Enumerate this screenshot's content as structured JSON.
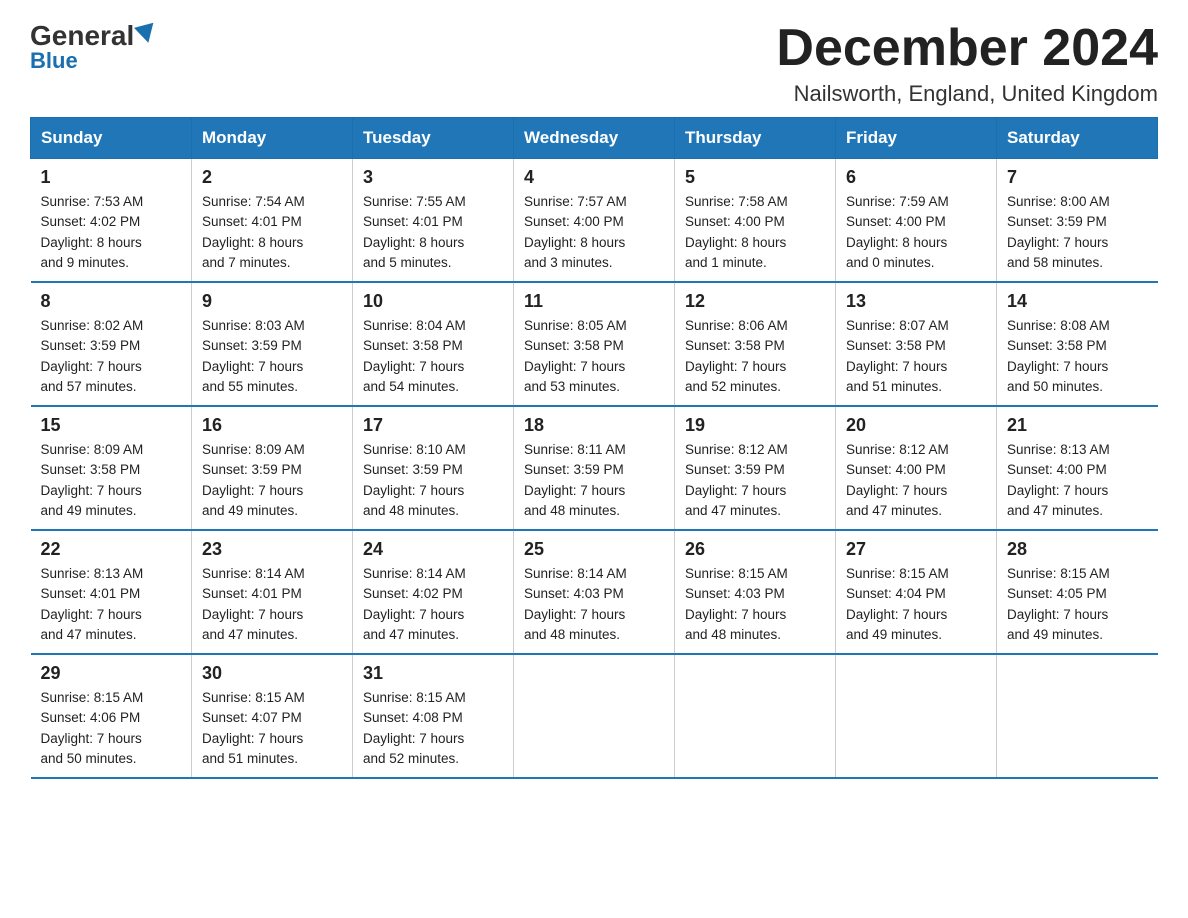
{
  "logo": {
    "general": "General",
    "blue": "Blue",
    "subtitle": "Blue"
  },
  "header": {
    "month_title": "December 2024",
    "location": "Nailsworth, England, United Kingdom"
  },
  "days_of_week": [
    "Sunday",
    "Monday",
    "Tuesday",
    "Wednesday",
    "Thursday",
    "Friday",
    "Saturday"
  ],
  "weeks": [
    [
      {
        "day": "1",
        "sunrise": "7:53 AM",
        "sunset": "4:02 PM",
        "daylight": "8 hours and 9 minutes."
      },
      {
        "day": "2",
        "sunrise": "7:54 AM",
        "sunset": "4:01 PM",
        "daylight": "8 hours and 7 minutes."
      },
      {
        "day": "3",
        "sunrise": "7:55 AM",
        "sunset": "4:01 PM",
        "daylight": "8 hours and 5 minutes."
      },
      {
        "day": "4",
        "sunrise": "7:57 AM",
        "sunset": "4:00 PM",
        "daylight": "8 hours and 3 minutes."
      },
      {
        "day": "5",
        "sunrise": "7:58 AM",
        "sunset": "4:00 PM",
        "daylight": "8 hours and 1 minute."
      },
      {
        "day": "6",
        "sunrise": "7:59 AM",
        "sunset": "4:00 PM",
        "daylight": "8 hours and 0 minutes."
      },
      {
        "day": "7",
        "sunrise": "8:00 AM",
        "sunset": "3:59 PM",
        "daylight": "7 hours and 58 minutes."
      }
    ],
    [
      {
        "day": "8",
        "sunrise": "8:02 AM",
        "sunset": "3:59 PM",
        "daylight": "7 hours and 57 minutes."
      },
      {
        "day": "9",
        "sunrise": "8:03 AM",
        "sunset": "3:59 PM",
        "daylight": "7 hours and 55 minutes."
      },
      {
        "day": "10",
        "sunrise": "8:04 AM",
        "sunset": "3:58 PM",
        "daylight": "7 hours and 54 minutes."
      },
      {
        "day": "11",
        "sunrise": "8:05 AM",
        "sunset": "3:58 PM",
        "daylight": "7 hours and 53 minutes."
      },
      {
        "day": "12",
        "sunrise": "8:06 AM",
        "sunset": "3:58 PM",
        "daylight": "7 hours and 52 minutes."
      },
      {
        "day": "13",
        "sunrise": "8:07 AM",
        "sunset": "3:58 PM",
        "daylight": "7 hours and 51 minutes."
      },
      {
        "day": "14",
        "sunrise": "8:08 AM",
        "sunset": "3:58 PM",
        "daylight": "7 hours and 50 minutes."
      }
    ],
    [
      {
        "day": "15",
        "sunrise": "8:09 AM",
        "sunset": "3:58 PM",
        "daylight": "7 hours and 49 minutes."
      },
      {
        "day": "16",
        "sunrise": "8:09 AM",
        "sunset": "3:59 PM",
        "daylight": "7 hours and 49 minutes."
      },
      {
        "day": "17",
        "sunrise": "8:10 AM",
        "sunset": "3:59 PM",
        "daylight": "7 hours and 48 minutes."
      },
      {
        "day": "18",
        "sunrise": "8:11 AM",
        "sunset": "3:59 PM",
        "daylight": "7 hours and 48 minutes."
      },
      {
        "day": "19",
        "sunrise": "8:12 AM",
        "sunset": "3:59 PM",
        "daylight": "7 hours and 47 minutes."
      },
      {
        "day": "20",
        "sunrise": "8:12 AM",
        "sunset": "4:00 PM",
        "daylight": "7 hours and 47 minutes."
      },
      {
        "day": "21",
        "sunrise": "8:13 AM",
        "sunset": "4:00 PM",
        "daylight": "7 hours and 47 minutes."
      }
    ],
    [
      {
        "day": "22",
        "sunrise": "8:13 AM",
        "sunset": "4:01 PM",
        "daylight": "7 hours and 47 minutes."
      },
      {
        "day": "23",
        "sunrise": "8:14 AM",
        "sunset": "4:01 PM",
        "daylight": "7 hours and 47 minutes."
      },
      {
        "day": "24",
        "sunrise": "8:14 AM",
        "sunset": "4:02 PM",
        "daylight": "7 hours and 47 minutes."
      },
      {
        "day": "25",
        "sunrise": "8:14 AM",
        "sunset": "4:03 PM",
        "daylight": "7 hours and 48 minutes."
      },
      {
        "day": "26",
        "sunrise": "8:15 AM",
        "sunset": "4:03 PM",
        "daylight": "7 hours and 48 minutes."
      },
      {
        "day": "27",
        "sunrise": "8:15 AM",
        "sunset": "4:04 PM",
        "daylight": "7 hours and 49 minutes."
      },
      {
        "day": "28",
        "sunrise": "8:15 AM",
        "sunset": "4:05 PM",
        "daylight": "7 hours and 49 minutes."
      }
    ],
    [
      {
        "day": "29",
        "sunrise": "8:15 AM",
        "sunset": "4:06 PM",
        "daylight": "7 hours and 50 minutes."
      },
      {
        "day": "30",
        "sunrise": "8:15 AM",
        "sunset": "4:07 PM",
        "daylight": "7 hours and 51 minutes."
      },
      {
        "day": "31",
        "sunrise": "8:15 AM",
        "sunset": "4:08 PM",
        "daylight": "7 hours and 52 minutes."
      },
      null,
      null,
      null,
      null
    ]
  ],
  "labels": {
    "sunrise": "Sunrise:",
    "sunset": "Sunset:",
    "daylight": "Daylight:"
  }
}
